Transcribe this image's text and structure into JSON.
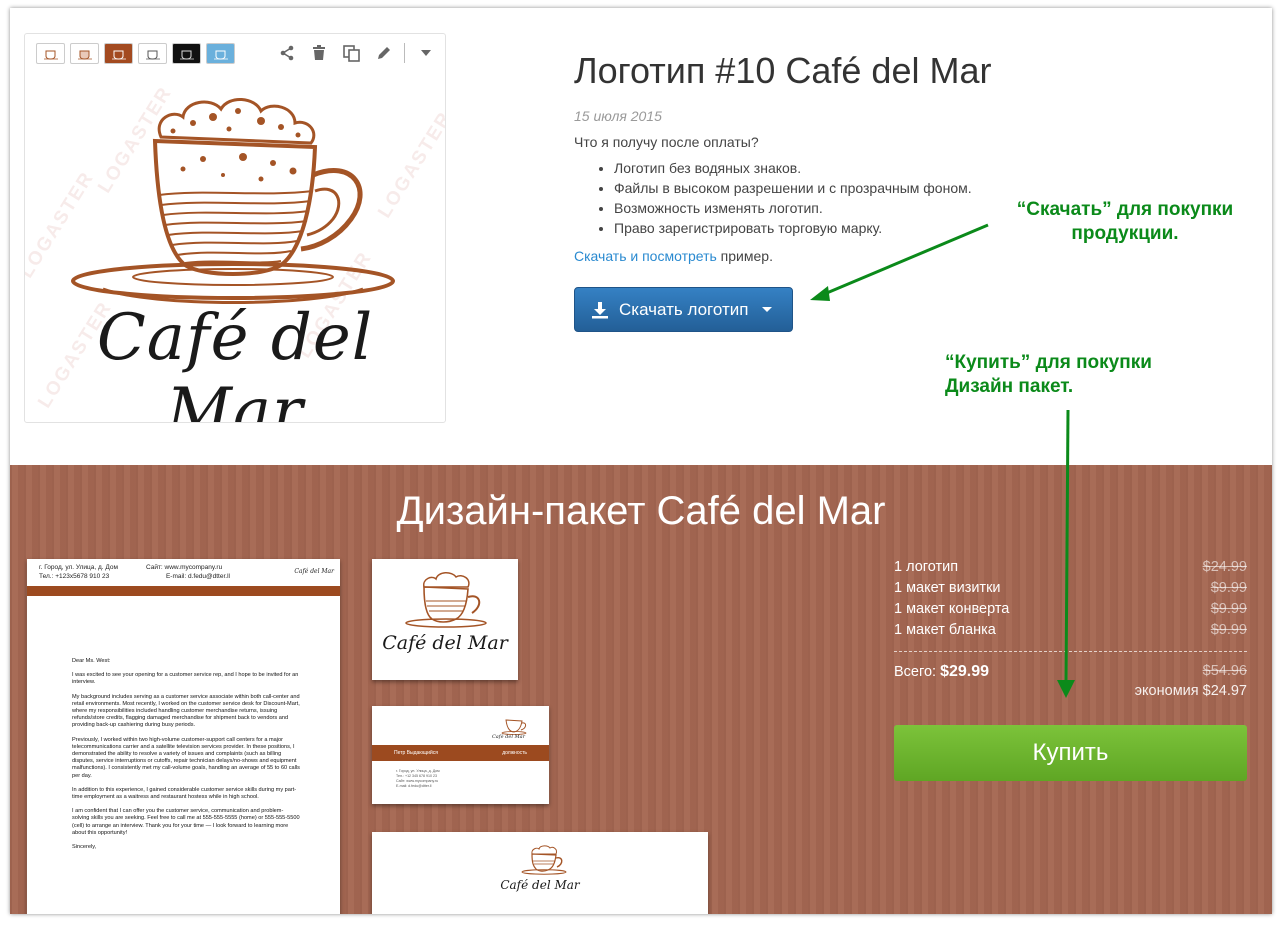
{
  "logo": {
    "title": "Логотип #10 Café del Mar",
    "date": "15 июля 2015",
    "brand_text": "Café del Mar",
    "watermark": "LOGASTER",
    "variants": [
      "variant-1",
      "variant-2",
      "variant-3",
      "variant-4",
      "variant-5",
      "variant-6"
    ],
    "variant_backgrounds": [
      "#ffffff",
      "#ffffff",
      "#a34a20",
      "#ffffff",
      "#111111",
      "#6ab0dc"
    ],
    "tools": [
      "share-icon",
      "trash-icon",
      "copy-icon",
      "pencil-icon",
      "chevron-down-icon"
    ],
    "accent_color": "#a45426"
  },
  "purchase_info": {
    "question": "Что я получу после оплаты?",
    "features": [
      "Логотип без водяных знаков.",
      "Файлы в высоком разрешении и с прозрачным фоном.",
      "Возможность изменять логотип.",
      "Право зарегистрировать торговую марку."
    ],
    "sample_link": "Скачать и посмотреть",
    "sample_suffix": " пример.",
    "download_button": "Скачать логотип"
  },
  "annotations": {
    "download_note": [
      "“Скачать” для покупки",
      "продукции."
    ],
    "buy_note": [
      "“Купить” для покупки",
      "Дизайн пакет."
    ],
    "color": "#0b8a1a"
  },
  "design_pack": {
    "title": "Дизайн-пакет Café del Mar",
    "background": "#a56752",
    "items": [
      {
        "label": "1 логотип",
        "price": "$24.99"
      },
      {
        "label": "1 макет визитки",
        "price": "$9.99"
      },
      {
        "label": "1 макет конверта",
        "price": "$9.99"
      },
      {
        "label": "1 макет бланка",
        "price": "$9.99"
      }
    ],
    "total_label": "Всего:",
    "total_price": "$29.99",
    "total_old": "$54.96",
    "saving": "экономия $24.97",
    "buy_button": "Купить"
  },
  "letterhead": {
    "address": "г. Город, ул. Улица, д. Дом",
    "phone": "Тел.: +123х5678 910 23",
    "site": "Сайт: www.mycompany.ru",
    "email": "E-mail: d.fedu@dtter.ll",
    "body": [
      "Dear Ms. West:",
      "I was excited to see your opening for a customer service rep, and I hope to be invited for an interview.",
      "My background includes serving as a customer service associate within both call-center and retail environments. Most recently, I worked on the customer service desk for Discount-Mart, where my responsibilities included handling customer merchandise returns, issuing refunds/store credits, flagging damaged merchandise for shipment back to vendors and providing back-up cashiering during busy periods.",
      "Previously, I worked within two high-volume customer-support call centers for a major telecommunications carrier and a satellite television services provider. In these positions, I demonstrated the ability to resolve a variety of issues and complaints (such as billing disputes, service interruptions or cutoffs, repair technician delays/no-shows and equipment malfunctions). I consistently met my call-volume goals, handling an average of 55 to 60 calls per day.",
      "In addition to this experience, I gained considerable customer service skills during my part-time employment as a waitress and restaurant hostess while in high school.",
      "I am confident that I can offer you the customer service, communication and problem-solving skills you are seeking. Feel free to call me at 555-555-5555 (home) or 555-555-5500 (cell) to arrange an interview. Thank you for your time — I look forward to learning more about this opportunity!",
      "Sincerely,"
    ]
  },
  "business_card": {
    "name": "Петр Выдающийся",
    "position": "должность",
    "lines": [
      "г. Город, ул. Улица, д. Дом",
      "Тел.: +12 345 678 910 23",
      "Сайт: www.mycompany.ru",
      "E-mail: d.fedu@dtter.ll"
    ]
  }
}
